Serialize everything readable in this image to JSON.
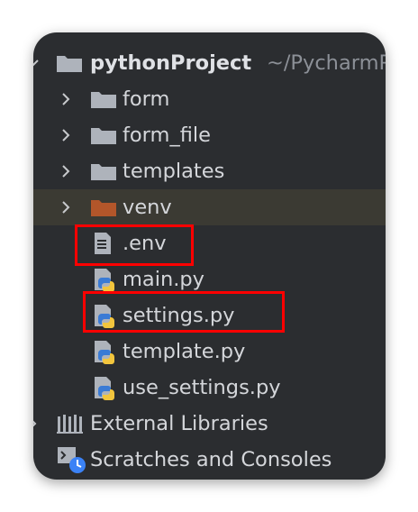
{
  "project": {
    "name": "pythonProject",
    "path": "~/PycharmP"
  },
  "tree": [
    {
      "label": "form",
      "type": "folder"
    },
    {
      "label": "form_file",
      "type": "folder"
    },
    {
      "label": "templates",
      "type": "folder"
    },
    {
      "label": "venv",
      "type": "folder-excluded",
      "highlighted": true
    },
    {
      "label": ".env",
      "type": "text-file",
      "boxed": true
    },
    {
      "label": "main.py",
      "type": "python-file"
    },
    {
      "label": "settings.py",
      "type": "python-file",
      "boxed": true
    },
    {
      "label": "template.py",
      "type": "python-file"
    },
    {
      "label": "use_settings.py",
      "type": "python-file"
    }
  ],
  "external_libraries": "External Libraries",
  "scratches": "Scratches and Consoles",
  "colors": {
    "panel_bg": "#2b2d30",
    "highlight_row": "#3b3a33",
    "folder_gray": "#aeb3bb",
    "folder_excluded": "#b3562a",
    "annotation_red": "#ff0000"
  }
}
